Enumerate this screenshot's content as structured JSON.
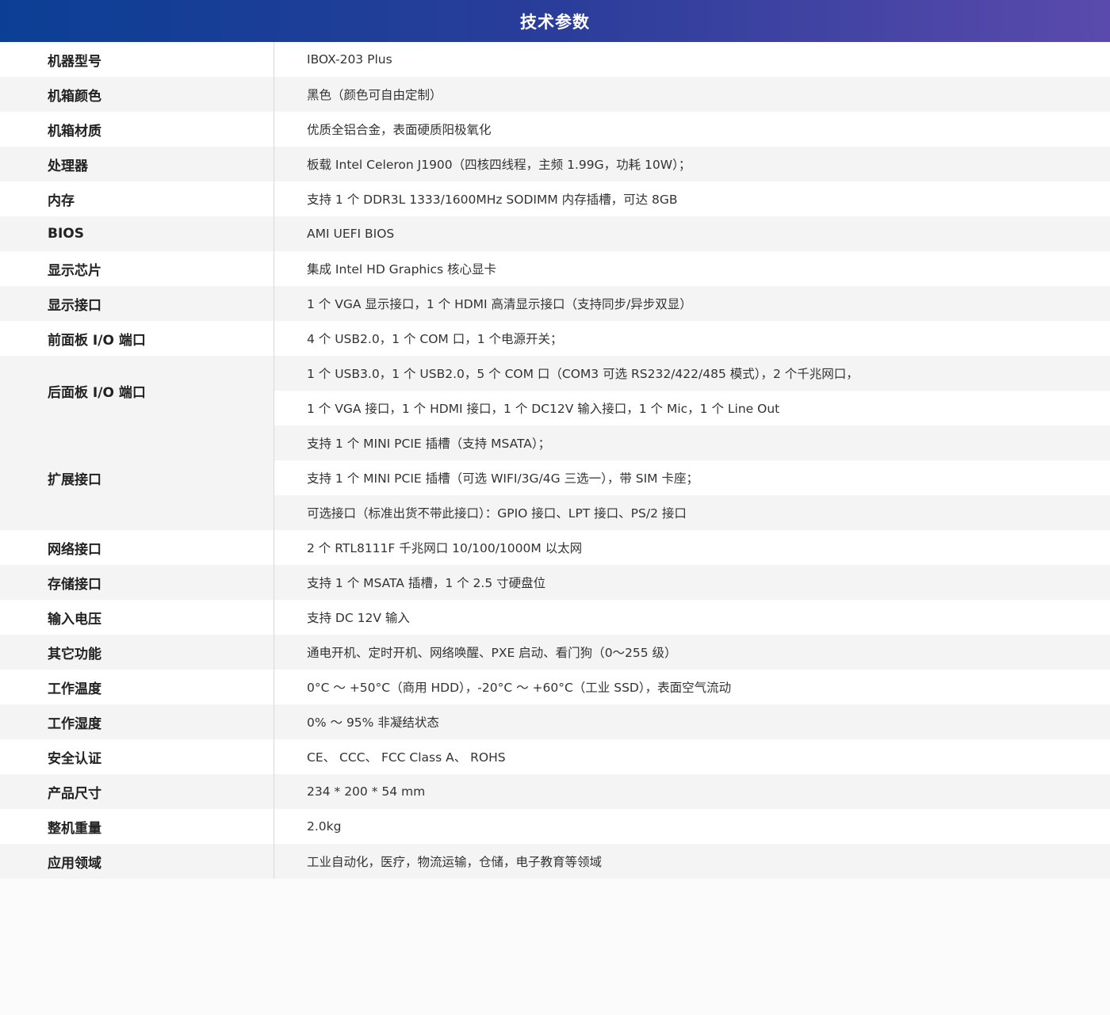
{
  "header": {
    "title": "技术参数"
  },
  "rows": [
    {
      "label": "机器型号",
      "values": [
        "IBOX-203 Plus"
      ]
    },
    {
      "label": "机箱颜色",
      "values": [
        "黑色（颜色可自由定制）"
      ]
    },
    {
      "label": "机箱材质",
      "values": [
        "优质全铝合金，表面硬质阳极氧化"
      ]
    },
    {
      "label": "处理器",
      "values": [
        "板载 Intel Celeron J1900（四核四线程，主频 1.99G，功耗 10W）；"
      ]
    },
    {
      "label": "内存",
      "values": [
        "支持 1 个 DDR3L 1333/1600MHz SODIMM 内存插槽，可达 8GB"
      ]
    },
    {
      "label": "BIOS",
      "values": [
        "AMI UEFI BIOS"
      ]
    },
    {
      "label": "显示芯片",
      "values": [
        "集成 Intel HD Graphics 核心显卡"
      ]
    },
    {
      "label": "显示接口",
      "values": [
        "1 个 VGA 显示接口，1 个 HDMI 高清显示接口（支持同步/异步双显）"
      ]
    },
    {
      "label": "前面板 I/O 端口",
      "values": [
        "4 个 USB2.0，1 个 COM 口，1 个电源开关；"
      ]
    },
    {
      "label": "后面板 I/O 端口",
      "values": [
        "1 个 USB3.0，1 个 USB2.0，5 个 COM 口（COM3 可选 RS232/422/485 模式），2 个千兆网口，",
        "1 个 VGA 接口，1 个 HDMI 接口，1 个 DC12V 输入接口，1 个 Mic，1 个 Line Out"
      ]
    },
    {
      "label": "扩展接口",
      "values": [
        "支持 1 个 MINI PCIE 插槽（支持 MSATA）；",
        "支持 1 个 MINI PCIE 插槽（可选 WIFI/3G/4G 三选一），带 SIM 卡座；",
        "可选接口（标准出货不带此接口）：GPIO 接口、LPT 接口、PS/2 接口"
      ]
    },
    {
      "label": "网络接口",
      "values": [
        "2 个 RTL8111F 千兆网口 10/100/1000M 以太网"
      ]
    },
    {
      "label": "存储接口",
      "values": [
        "支持 1 个 MSATA 插槽，1 个 2.5 寸硬盘位"
      ]
    },
    {
      "label": "输入电压",
      "values": [
        "支持 DC 12V 输入"
      ]
    },
    {
      "label": "其它功能",
      "values": [
        "通电开机、定时开机、网络唤醒、PXE 启动、看门狗（0～255 级）"
      ]
    },
    {
      "label": "工作温度",
      "values": [
        "0°C ～ +50°C（商用 HDD），-20°C ～ +60°C（工业 SSD），表面空气流动"
      ]
    },
    {
      "label": "工作湿度",
      "values": [
        "0% ～ 95% 非凝结状态"
      ]
    },
    {
      "label": "安全认证",
      "values": [
        "CE、 CCC、 FCC Class A、 ROHS"
      ]
    },
    {
      "label": "产品尺寸",
      "values": [
        "234 * 200 * 54 mm"
      ]
    },
    {
      "label": "整机重量",
      "values": [
        "2.0kg"
      ]
    },
    {
      "label": "应用领域",
      "values": [
        "工业自动化，医疗，物流运输，仓储，电子教育等领域"
      ]
    }
  ]
}
